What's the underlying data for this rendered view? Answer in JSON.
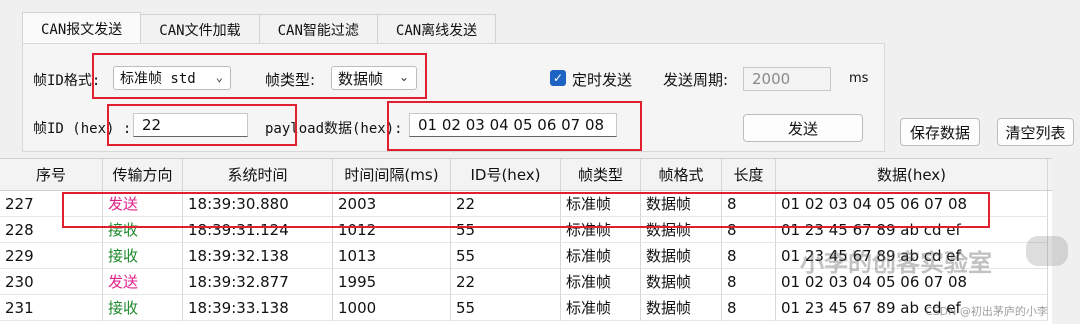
{
  "tabs": [
    "CAN报文发送",
    "CAN文件加载",
    "CAN智能过滤",
    "CAN离线发送"
  ],
  "form": {
    "frame_id_format_label": "帧ID格式:",
    "frame_id_format_value": "标准帧 std",
    "frame_type_label": "帧类型:",
    "frame_type_value": "数据帧",
    "timed_send_label": "定时发送",
    "send_period_label": "发送周期:",
    "send_period_value": "2000",
    "send_period_unit": "ms",
    "frame_id_label": "帧ID (hex) :",
    "frame_id_value": "22",
    "payload_label": "payload数据(hex):",
    "payload_value": "01 02 03 04 05 06 07 08",
    "send_button": "发送",
    "save_button": "保存数据",
    "clear_button": "清空列表"
  },
  "table": {
    "columns": [
      "序号",
      "传输方向",
      "系统时间",
      "时间间隔(ms)",
      "ID号(hex)",
      "帧类型",
      "帧格式",
      "长度",
      "数据(hex)"
    ],
    "rows": [
      [
        "227",
        "发送",
        "18:39:30.880",
        "2003",
        "22",
        "标准帧",
        "数据帧",
        "8",
        "01 02 03 04 05 06 07 08"
      ],
      [
        "228",
        "接收",
        "18:39:31.124",
        "1012",
        "55",
        "标准帧",
        "数据帧",
        "8",
        "01 23 45 67 89 ab cd ef"
      ],
      [
        "229",
        "接收",
        "18:39:32.138",
        "1013",
        "55",
        "标准帧",
        "数据帧",
        "8",
        "01 23 45 67 89 ab cd ef"
      ],
      [
        "230",
        "发送",
        "18:39:32.877",
        "1995",
        "22",
        "标准帧",
        "数据帧",
        "8",
        "01 02 03 04 05 06 07 08"
      ],
      [
        "231",
        "接收",
        "18:39:33.138",
        "1000",
        "55",
        "标准帧",
        "数据帧",
        "8",
        "01 23 45 67 89 ab cd ef"
      ]
    ]
  },
  "watermark": "小李的创客实验室",
  "watermark_sub": "CSDN @初出茅庐的小李",
  "colors": {
    "send": "#e0208a",
    "recv": "#1f8a2c",
    "highlight": "#e02030",
    "checkbox": "#1e63c3"
  }
}
